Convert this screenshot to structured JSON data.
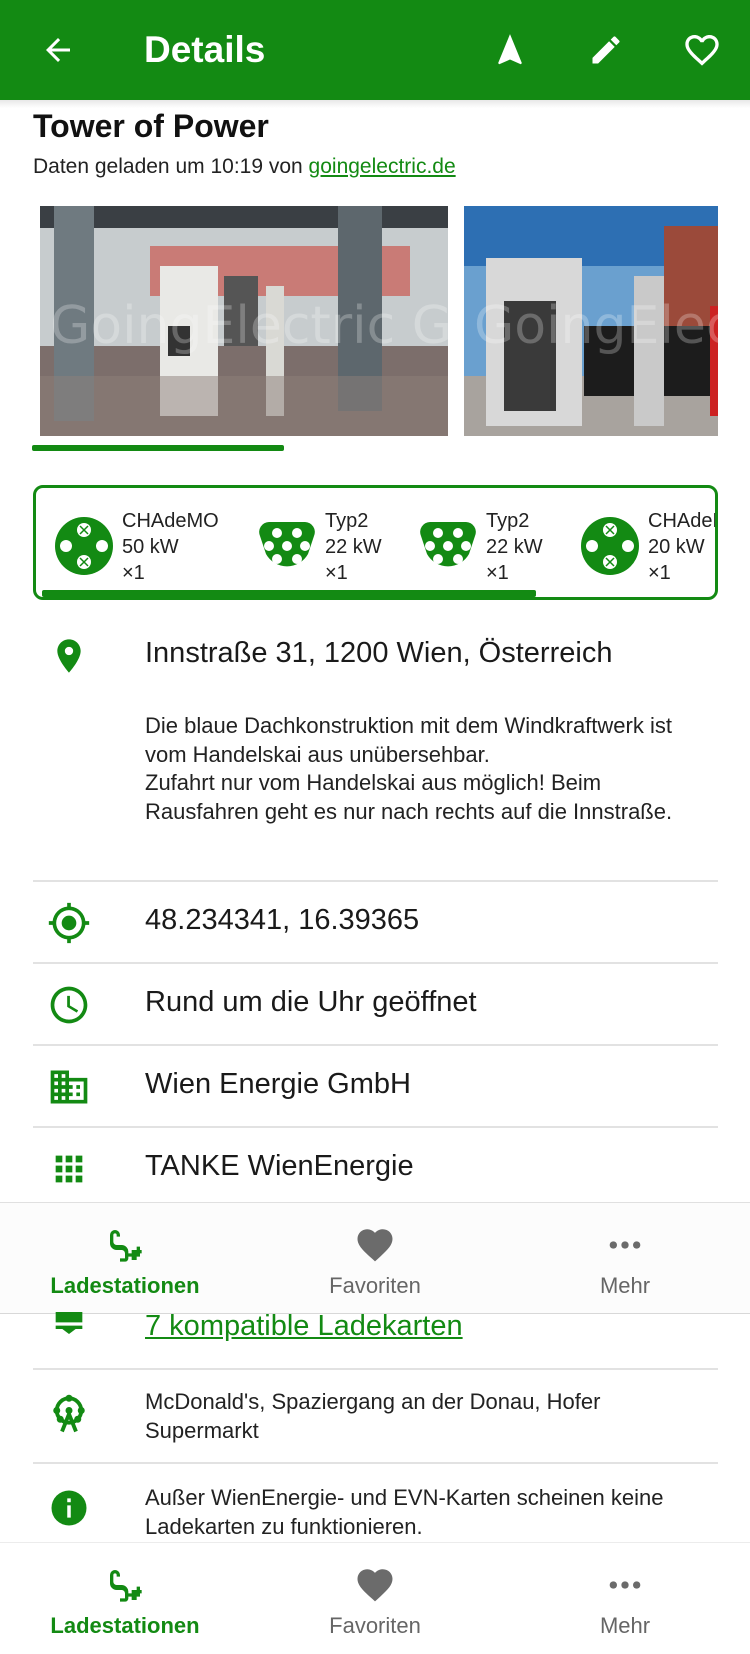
{
  "appbar": {
    "title": "Details",
    "back_icon": "arrow-back-icon",
    "actions": [
      "navigate-icon",
      "edit-icon",
      "favorite-outline-icon"
    ]
  },
  "colors": {
    "primary": "#138a13",
    "white": "#ffffff",
    "divider": "#e2e2e2"
  },
  "station": {
    "name": "Tower of Power",
    "loaded_prefix": "Daten geladen um 10:19 von ",
    "source_link": "goingelectric.de",
    "watermark": "GoingElectric GoingElectric"
  },
  "connectors": [
    {
      "type": "CHAdeMO",
      "power": "50 kW",
      "count": "×1",
      "icon": "chademo-plug-icon"
    },
    {
      "type": "Typ2",
      "power": "22 kW",
      "count": "×1",
      "icon": "type2-plug-icon"
    },
    {
      "type": "Typ2",
      "power": "22 kW",
      "count": "×1",
      "icon": "type2-plug-icon"
    },
    {
      "type": "CHAdeMO",
      "power": "20 kW",
      "count": "×1",
      "icon": "chademo-plug-icon"
    }
  ],
  "details": {
    "address": "Innstraße 31, 1200 Wien, Österreich",
    "description": "Die blaue Dachkonstruktion mit dem Windkraftwerk ist vom Handelskai aus unübersehbar.\nZufahrt nur vom Handelskai aus möglich! Beim Rausfahren geht es nur nach rechts auf die Innstraße.",
    "coordinates": "48.234341, 16.39365",
    "hours": "Rund um die Uhr geöffnet",
    "operator": "Wien Energie GmbH",
    "network": "TANKE WienEnergie",
    "chargecards": "7 kompatible Ladekarten",
    "amenities": "McDonald's, Spaziergang an der Donau, Hofer Supermarkt",
    "info": "Außer WienEnergie- und EVN-Karten scheinen keine Ladekarten zu funktionieren."
  },
  "nav": {
    "items": [
      {
        "label": "Ladestationen",
        "icon": "ev-station-icon",
        "active": true
      },
      {
        "label": "Favoriten",
        "icon": "heart-icon",
        "active": false
      },
      {
        "label": "Mehr",
        "icon": "more-horiz-icon",
        "active": false
      }
    ]
  }
}
